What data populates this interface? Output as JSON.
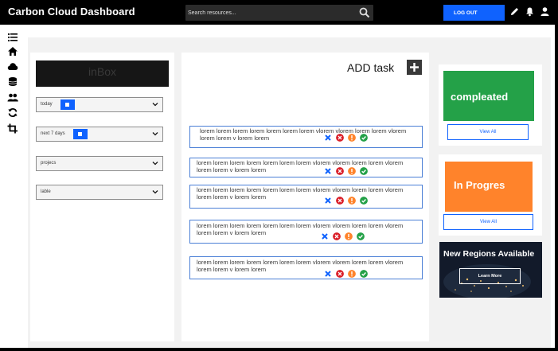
{
  "header": {
    "title": "Carbon Cloud Dashboard",
    "search_placeholder": "Search resources...",
    "logout_label": "LOG OUT",
    "icons": [
      "edit-icon",
      "notification-icon",
      "user-icon"
    ]
  },
  "sidebar": {
    "icons": [
      "list-icon",
      "home-icon",
      "cloud-icon",
      "database-icon",
      "users-icon",
      "refresh-icon",
      "crop-icon"
    ]
  },
  "left": {
    "inbox_label": "inBox",
    "filters": [
      {
        "label": "today",
        "has_calendar": true
      },
      {
        "label": "next 7 days",
        "has_calendar": true
      },
      {
        "label": "projecs",
        "has_calendar": false
      },
      {
        "label": "lable",
        "has_calendar": false
      }
    ]
  },
  "center": {
    "add_task_label": "ADD task",
    "tasks": [
      {
        "text": "lorem lorem lorem lorem lorem lorem lorem vlorem vlorem lorem lorem vlorem lorem lorem v lorem lorem"
      },
      {
        "text": "lorem lorem lorem lorem lorem lorem lorem vlorem vlorem lorem lorem vlorem lorem lorem v lorem lorem"
      },
      {
        "text": "lorem lorem lorem lorem lorem lorem lorem vlorem vlorem lorem lorem vlorem lorem lorem v lorem lorem"
      },
      {
        "text": "lorem lorem lorem lorem lorem lorem lorem vlorem vlorem lorem lorem vlorem lorem lorem v lorem lorem"
      },
      {
        "text": "lorem lorem lorem lorem lorem lorem lorem vlorem vlorem lorem lorem vlorem lorem lorem v lorem lorem"
      }
    ]
  },
  "right": {
    "completed_label": "compleated",
    "completed_color": "#24a148",
    "progress_label": "In Progres",
    "progress_color": "#ff832b",
    "view_all_label": "View All",
    "regions_title": "New Regions Available",
    "learn_more_label": "Learn More"
  },
  "colors": {
    "accent": "#0f62fe",
    "danger": "#da1e28",
    "warning": "#ff832b",
    "success": "#24a148"
  }
}
